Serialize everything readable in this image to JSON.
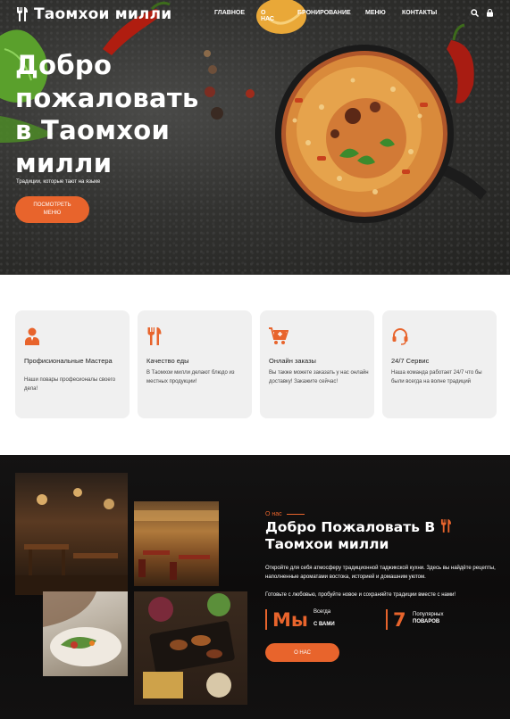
{
  "brand": {
    "name": "Таомхои милли",
    "accent": "#e8642c"
  },
  "nav": {
    "items": [
      "ГЛАВНОЕ",
      "О НАС",
      "БРОНИРОВАНИЕ",
      "МЕНЮ",
      "КОНТАКТЫ"
    ],
    "icons": [
      "search-icon",
      "cart-icon"
    ]
  },
  "hero": {
    "title": "Добро пожаловать в Таомхои милли",
    "subtitle": "Традиции, которые тают на языке",
    "button": "ПОСМОТРЕТЬ МЕНЮ"
  },
  "features": [
    {
      "icon": "chef-icon",
      "title": "Профисиональные Мастера",
      "text": "Наши повары професионалы своего дела!"
    },
    {
      "icon": "fork-knife-icon",
      "title": "Качество еды",
      "text": "В Таомхои милли делают блюдо из местных продукции!"
    },
    {
      "icon": "cart-plus-icon",
      "title": "Онлайн заказы",
      "text": "Вы также можете заказать у нас онлайн доставку! Закажите сейчас!"
    },
    {
      "icon": "headset-icon",
      "title": "24/7 Сервис",
      "text": "Наша команда работает 24/7 что бы были всегда на волне традиций"
    }
  ],
  "about": {
    "label": "О нас",
    "title_line1": "Добро Пожаловать В",
    "title_line2": "Таомхои милли",
    "p1": "Откройте для себя атмосферу традиционной таджикской кухни. Здесь вы найдёте рецепты, наполненные ароматами востока, историей и домашним уютом.",
    "p2": "Готовьте с любовью, пробуйте новое и сохраняйте традиции вместе с нами!",
    "stats": [
      {
        "number": "Мы",
        "line1": "Всегда",
        "line2": "с вами"
      },
      {
        "number": "7",
        "line1": "Популярных",
        "line2": "поваров"
      }
    ],
    "button": "О НАС"
  }
}
